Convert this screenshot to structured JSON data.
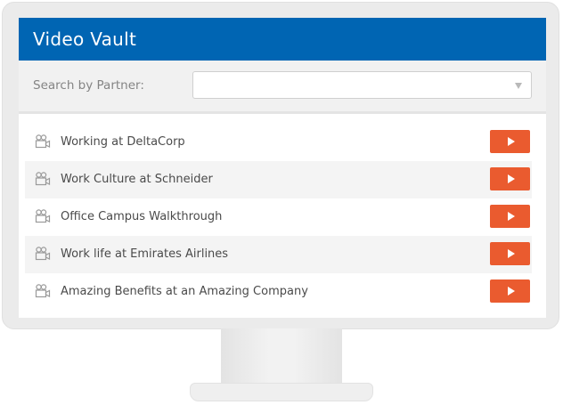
{
  "app": {
    "title": "Video Vault"
  },
  "search": {
    "label": "Search by Partner:",
    "value": ""
  },
  "videos": [
    {
      "title": "Working at DeltaCorp",
      "icon": "video-camera-icon",
      "action_icon": "play-icon"
    },
    {
      "title": "Work Culture at Schneider",
      "icon": "video-camera-icon",
      "action_icon": "play-icon"
    },
    {
      "title": "Office Campus Walkthrough",
      "icon": "video-camera-icon",
      "action_icon": "play-icon"
    },
    {
      "title": "Work life at Emirates Airlines",
      "icon": "video-camera-icon",
      "action_icon": "play-icon"
    },
    {
      "title": "Amazing Benefits at an Amazing Company",
      "icon": "video-camera-icon",
      "action_icon": "play-icon"
    }
  ],
  "colors": {
    "header_bg": "#0065b3",
    "play_button": "#ea5b2f",
    "bezel": "#ebebeb"
  }
}
